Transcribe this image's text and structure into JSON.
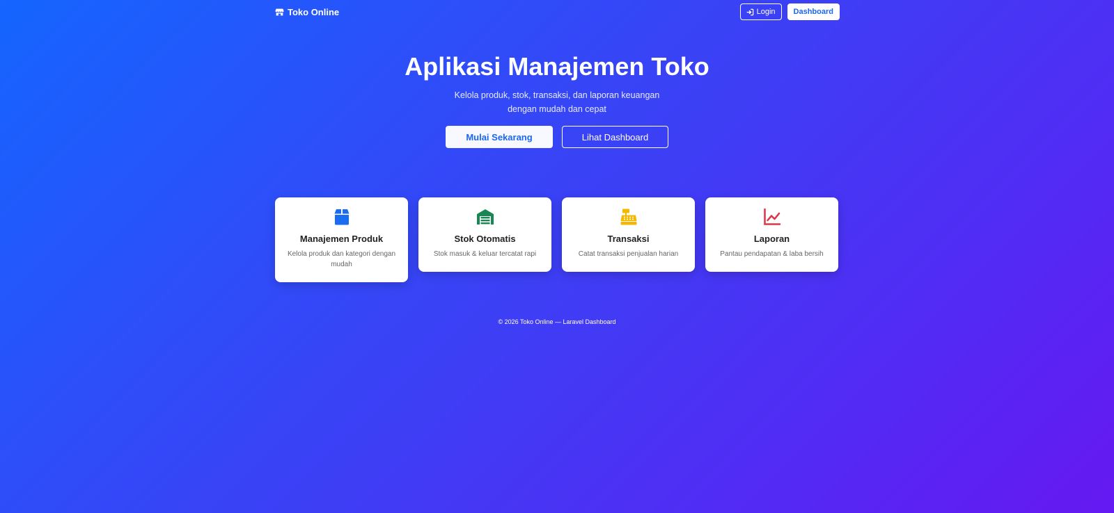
{
  "nav": {
    "brand": "Toko Online",
    "login_label": "Login",
    "dashboard_label": "Dashboard"
  },
  "hero": {
    "title": "Aplikasi Manajemen Toko",
    "subtitle": "Kelola produk, stok, transaksi, dan laporan keuangan dengan mudah dan cepat",
    "primary_button": "Mulai Sekarang",
    "secondary_button": "Lihat Dashboard"
  },
  "features": [
    {
      "icon": "box-icon",
      "color": "#1a6cf0",
      "title": "Manajemen Produk",
      "description": "Kelola produk dan kategori dengan mudah"
    },
    {
      "icon": "warehouse-icon",
      "color": "#198754",
      "title": "Stok Otomatis",
      "description": "Stok masuk & keluar tercatat rapi"
    },
    {
      "icon": "cash-register-icon",
      "color": "#f5b800",
      "title": "Transaksi",
      "description": "Catat transaksi penjualan harian"
    },
    {
      "icon": "chart-line-icon",
      "color": "#dc3545",
      "title": "Laporan",
      "description": "Pantau pendapatan & laba bersih"
    }
  ],
  "footer": {
    "text": "© 2026 Toko Online — Laravel Dashboard"
  }
}
